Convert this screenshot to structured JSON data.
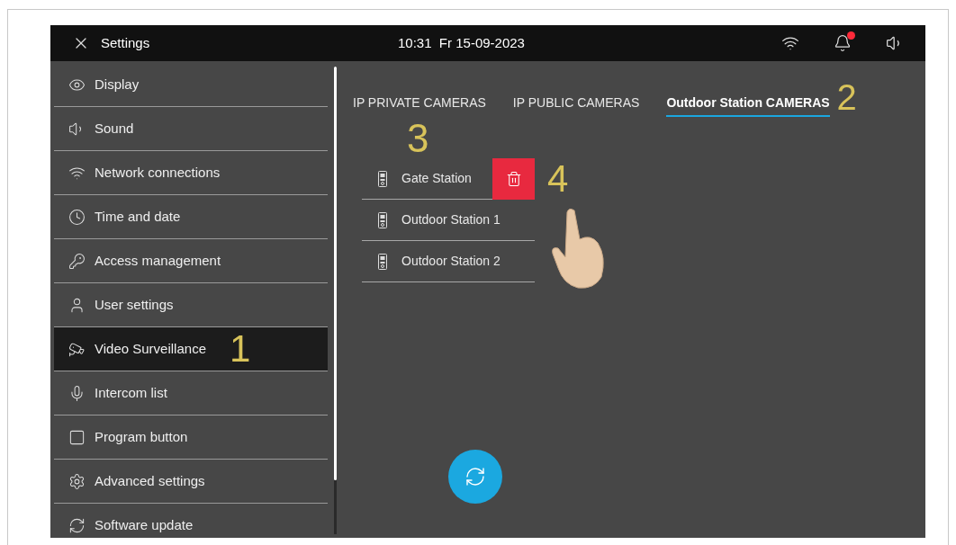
{
  "header": {
    "title": "Settings",
    "datetime": "10:31  Fr 15-09-2023",
    "notification": true
  },
  "sidebar": {
    "items": [
      {
        "label": "Display",
        "selected": false
      },
      {
        "label": "Sound",
        "selected": false
      },
      {
        "label": "Network connections",
        "selected": false
      },
      {
        "label": "Time and date",
        "selected": false
      },
      {
        "label": "Access  management",
        "selected": false
      },
      {
        "label": "User settings",
        "selected": false
      },
      {
        "label": "Video Surveillance",
        "selected": true,
        "callout": "1"
      },
      {
        "label": "Intercom list",
        "selected": false
      },
      {
        "label": "Program button",
        "selected": false
      },
      {
        "label": "Advanced settings",
        "selected": false
      },
      {
        "label": "Software update",
        "selected": false
      }
    ]
  },
  "tabs": [
    {
      "label": "IP PRIVATE CAMERAS",
      "selected": false
    },
    {
      "label": "IP PUBLIC CAMERAS",
      "selected": false
    },
    {
      "label": "Outdoor Station CAMERAS",
      "selected": true,
      "callout": "2"
    }
  ],
  "list_callout": "3",
  "stations": [
    {
      "label": "Gate Station",
      "delete_revealed": true,
      "callout": "4"
    },
    {
      "label": "Outdoor Station 1",
      "delete_revealed": false
    },
    {
      "label": "Outdoor Station 2",
      "delete_revealed": false
    }
  ]
}
